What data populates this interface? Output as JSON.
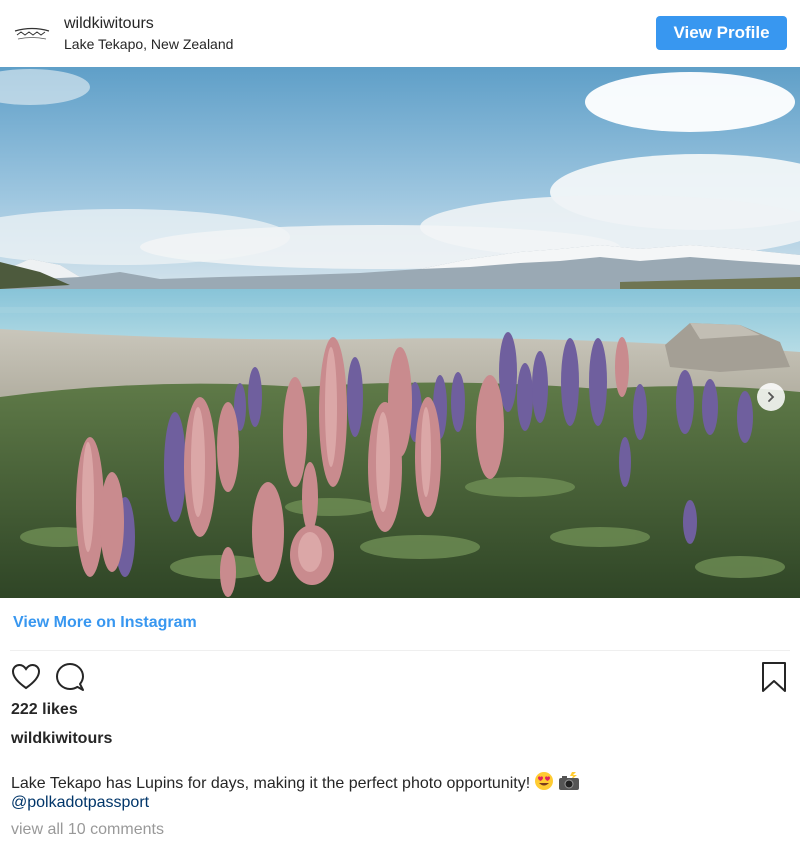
{
  "header": {
    "username": "wildkiwitours",
    "location": "Lake Tekapo, New Zealand",
    "view_profile_label": "View Profile",
    "avatar_icon": "wildkiwi-logo-icon"
  },
  "post": {
    "photo_icon": "lake-tekapo-lupins-photo",
    "next_icon": "chevron-right-icon",
    "view_more_label": "View More on Instagram",
    "likes": "222 likes",
    "caption_user": "wildkiwitours",
    "caption_text": "Lake Tekapo has Lupins for days, making it the perfect photo opportunity!",
    "caption_emojis": [
      "heart-eyes-emoji",
      "camera-with-flash-emoji"
    ],
    "mention": "@polkadotpassport",
    "comments_link": "view all 10 comments"
  },
  "actions": {
    "icons": [
      "heart-icon",
      "comment-icon",
      "bookmark-icon"
    ]
  },
  "colors": {
    "accent": "#3897f0",
    "mention": "#003569",
    "muted": "#999999",
    "text": "#262626"
  }
}
